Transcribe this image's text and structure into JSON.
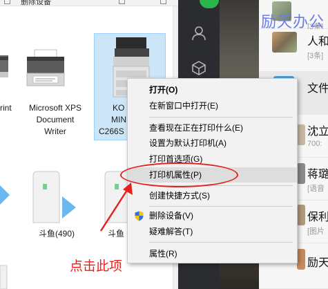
{
  "explorer": {
    "toolbar_label": "删除设备",
    "devices_row1": [
      {
        "label_line1": "rint",
        "label_line2": "",
        "label_line3": ""
      },
      {
        "label_line1": "Microsoft XPS",
        "label_line2": "Document",
        "label_line3": "Writer"
      },
      {
        "label_line1": "KO",
        "label_line2": "MIN",
        "label_line3": "C266S"
      }
    ],
    "devices_row2": [
      {
        "label": "斗鱼(490)"
      },
      {
        "label": "斗鱼"
      }
    ]
  },
  "context_menu": {
    "items": [
      {
        "label": "打开(O)",
        "bold": true
      },
      {
        "label": "在新窗口中打开(E)"
      },
      {
        "label": "查看现在正在打印什么(E)"
      },
      {
        "label": "设置为默认打印机(A)"
      },
      {
        "label": "打印首选项(G)"
      },
      {
        "label": "打印机属性(P)",
        "highlighted": true
      },
      {
        "label": "创建快捷方式(S)"
      },
      {
        "label": "删除设备(V)"
      },
      {
        "label": "疑难解答(T)"
      },
      {
        "label": "属性(R)"
      }
    ]
  },
  "annotation": {
    "text": "点击此项",
    "color": "#e8201c"
  },
  "chat": {
    "watermark": "励天办公",
    "rows": [
      {
        "title": "",
        "sub": "[3条]"
      },
      {
        "title": "人和",
        "sub": "[3条]"
      },
      {
        "title": "文件",
        "sub": ""
      },
      {
        "title": "沈立",
        "sub": "700:"
      },
      {
        "title": "蒋璐",
        "sub": "[语音"
      },
      {
        "title": "保利",
        "sub": "[图片"
      },
      {
        "title": "励天",
        "sub": ""
      }
    ]
  }
}
